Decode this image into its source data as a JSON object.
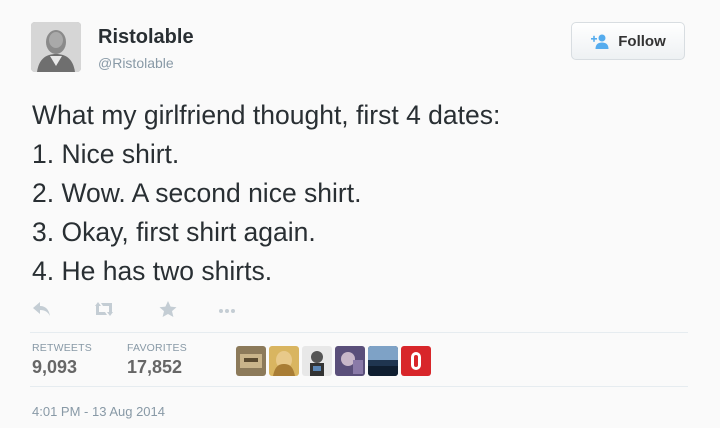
{
  "header": {
    "name": "Ristolable",
    "handle": "@Ristolable",
    "follow_label": "Follow"
  },
  "tweet": {
    "lines": [
      "What my girlfriend thought, first 4 dates:",
      "1. Nice shirt.",
      "2. Wow. A second nice shirt.",
      "3. Okay, first shirt again.",
      "4. He has two shirts."
    ]
  },
  "actions": {
    "icons": [
      "reply-icon",
      "retweet-icon",
      "favorite-icon",
      "more-icon"
    ]
  },
  "stats": {
    "retweets_label": "RETWEETS",
    "retweets_value": "9,093",
    "favorites_label": "FAVORITES",
    "favorites_value": "17,852"
  },
  "timestamp": "4:01 PM - 13 Aug 2014",
  "colors": {
    "text": "#292f33",
    "muted": "#8899a6",
    "icon_muted": "#c4cdd4",
    "follow_icon": "#55acee"
  }
}
